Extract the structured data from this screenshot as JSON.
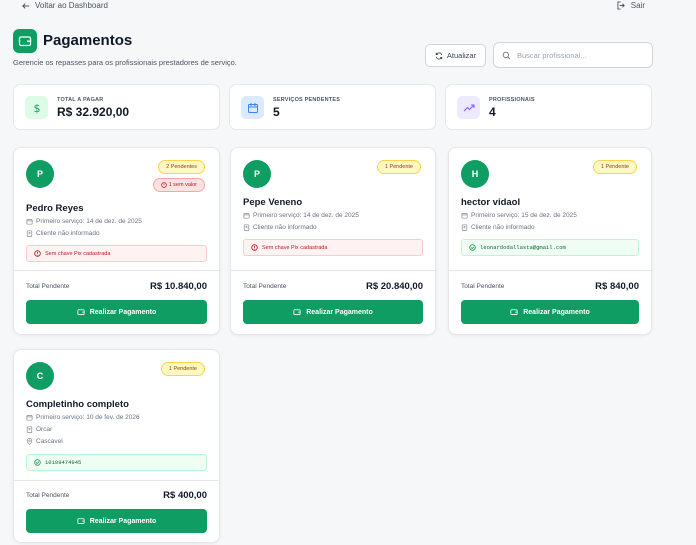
{
  "header": {
    "back_label": "Voltar ao Dashboard",
    "logout_label": "Sair",
    "title": "Pagamentos",
    "subtitle": "Gerencie os repasses para os profissionais prestadores de serviço.",
    "refresh_label": "Atualizar",
    "search_placeholder": "Buscar profissional..."
  },
  "stats": [
    {
      "label": "TOTAL A PAGAR",
      "value": "R$ 32.920,00",
      "icon": "dollar-icon",
      "color": "#0f9d63"
    },
    {
      "label": "SERVIÇOS PENDENTES",
      "value": "5",
      "icon": "calendar-icon",
      "color": "#3b82f6"
    },
    {
      "label": "PROFISSIONAIS",
      "value": "4",
      "icon": "trending-up-icon",
      "color": "#8b5cf6"
    }
  ],
  "cards": [
    {
      "initial": "P",
      "name": "Pedro Reyes",
      "pending": "2 Pendentes",
      "no_value": "1 sem valor",
      "first_service": "Primeiro serviço: 14 de dez. de 2025",
      "client": "Cliente não informado",
      "pix": "Sem chave Pix cadastrada",
      "total_label": "Total Pendente",
      "total": "R$ 10.840,00",
      "pay_label": "Realizar Pagamento"
    },
    {
      "initial": "P",
      "name": "Pepe Veneno",
      "pending": "1 Pendente",
      "first_service": "Primeiro serviço: 14 de dez. de 2025",
      "client": "Cliente não informado",
      "pix": "Sem chave Pix cadastrada",
      "total_label": "Total Pendente",
      "total": "R$ 20.840,00",
      "pay_label": "Realizar Pagamento"
    },
    {
      "initial": "H",
      "name": "hector vidaol",
      "pending": "1 Pendente",
      "first_service": "Primeiro serviço: 15 de dez. de 2025",
      "client": "Cliente não informado",
      "pix": "leonardodallasta@gmail.com",
      "total_label": "Total Pendente",
      "total": "R$ 840,00",
      "pay_label": "Realizar Pagamento"
    },
    {
      "initial": "C",
      "name": "Completinho completo",
      "pending": "1 Pendente",
      "first_service": "Primeiro serviço: 10 de fev. de 2026",
      "client": "Orcar",
      "location": "Cascavel",
      "pix": "10109474945",
      "total_label": "Total Pendente",
      "total": "R$ 400,00",
      "pay_label": "Realizar Pagamento"
    }
  ],
  "colors": {
    "accent": "#0f9d63",
    "warning": "#fcd34d",
    "error": "#b91c1c"
  }
}
